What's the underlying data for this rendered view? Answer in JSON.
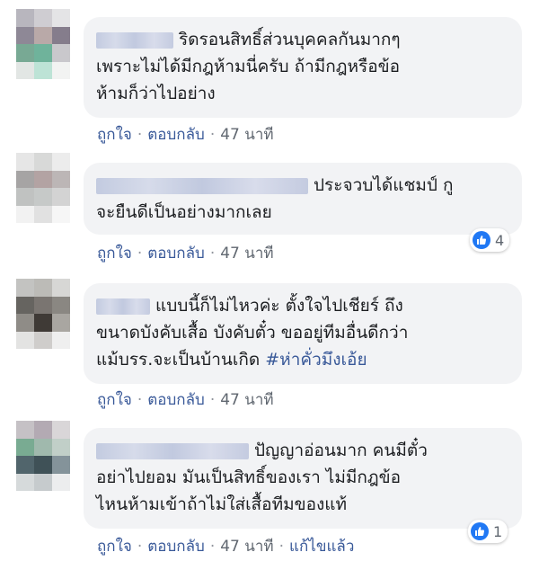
{
  "comments": [
    {
      "line1": "ริดรอนสิทธิ์ส่วนบุคคลกันมากๆ",
      "line2": "เพราะไม่ได้มีกฎห้ามนี่ครับ ถ้ามีกฎหรือข้อ",
      "line3": "ห้ามก็ว่าไปอย่าง",
      "like_label": "ถูกใจ",
      "reply_label": "ตอบกลับ",
      "time": "47 นาที"
    },
    {
      "line1": "ประจวบได้แชมป์ กู",
      "line2": "จะยืนดีเป็นอย่างมากเลย",
      "like_label": "ถูกใจ",
      "reply_label": "ตอบกลับ",
      "time": "47 นาที",
      "reaction_count": "4"
    },
    {
      "line1": "แบบนี้ก็ไม่ไหวค่ะ ตั้งใจไปเชียร์ ถึง",
      "line2": "ขนาดบังคับเสื้อ บังคับตั๋ว ขออยู่ทีมอื่นดีกว่า",
      "line3_text": "แม้บรร.จะเป็นบ้านเกิด ",
      "hashtag": "#ห่าคั่วมึงเอ้ย",
      "like_label": "ถูกใจ",
      "reply_label": "ตอบกลับ",
      "time": "47 นาที"
    },
    {
      "line1": "ปัญญาอ่อนมาก คนมีตั๋ว",
      "line2": "อย่าไปยอม มันเป็นสิทธิ์ของเรา ไม่มีกฎข้อ",
      "line3": "ไหนห้ามเข้าถ้าไม่ใส่เสื้อทีมของแท้",
      "like_label": "ถูกใจ",
      "reply_label": "ตอบกลับ",
      "time": "47 นาที",
      "edited_label": "แก้ไขแล้ว",
      "reaction_count": "1"
    }
  ],
  "separator": "·",
  "colors": {
    "link": "#385898",
    "bubble": "#f2f3f5",
    "like_blue": "#2078f4"
  },
  "icons": {
    "reaction": "like-thumb-icon"
  }
}
